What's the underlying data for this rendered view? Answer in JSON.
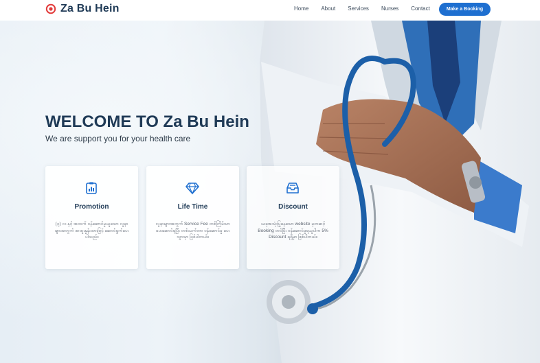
{
  "brand": {
    "name": "Za Bu Hein",
    "accent": "#e23b3b",
    "primary": "#1e6fd0",
    "navy": "#1f3a56"
  },
  "nav": {
    "items": [
      "Home",
      "About",
      "Services",
      "Nurses",
      "Contact"
    ],
    "cta": "Make a Booking"
  },
  "hero": {
    "title": "WELCOME TO Za Bu Hein",
    "subtitle": "We are support you for your health care"
  },
  "cards": [
    {
      "icon": "clipboard-chart-icon",
      "title": "Promotion",
      "desc": "(၃) လ နှင့် အထက် ဝန်ဆောင်မှုယူသော လူနာများအတွက် အထူးနှုန်းထားဖြင့် ဆောင်ရွက်ပေးပါသည်။"
    },
    {
      "icon": "diamond-icon",
      "title": "Life Time",
      "desc": "လူနာများအတွက် Service Fee တစ်ကြိမ်သာပေးဆောင်ရပြီး တစ်သက်တာ ဝန်ဆောင်မှု ပေးသွားမှာ ဖြစ်ပါတယ်။"
    },
    {
      "icon": "inbox-tray-icon",
      "title": "Discount",
      "desc": "ယခုအသုံးပြုနေသော website မှတဆင့် Booking တင်ပြီး ဝန်ဆောင်မှုရယူပါက 5% Discount ရရှိမှာ ဖြစ်ပါတယ်။"
    }
  ]
}
